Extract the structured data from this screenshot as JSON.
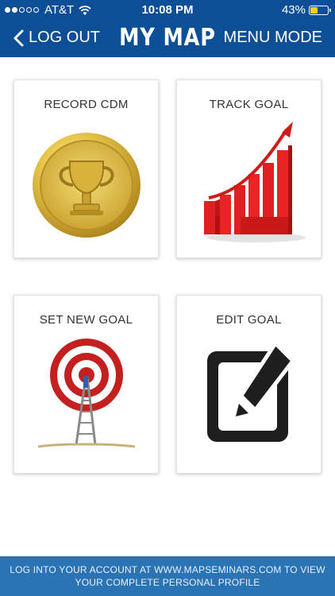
{
  "status_bar": {
    "carrier": "AT&T",
    "time": "10:08 PM",
    "battery": "43%",
    "battery_level": 0.43,
    "signal_bars_filled": 2,
    "signal_bars_total": 5
  },
  "nav": {
    "back_label": "LOG OUT",
    "title": "MY MAP",
    "menu_label": "MENU MODE"
  },
  "cards": [
    {
      "label": "RECORD CDM",
      "icon": "trophy-coin-icon"
    },
    {
      "label": "TRACK GOAL",
      "icon": "growth-chart-icon"
    },
    {
      "label": "SET NEW GOAL",
      "icon": "target-ladder-icon"
    },
    {
      "label": "EDIT GOAL",
      "icon": "edit-icon"
    }
  ],
  "footer": {
    "line1": "LOG INTO YOUR ACCOUNT AT WWW.MAPSEMINARS.COM TO VIEW",
    "line2": "YOUR COMPLETE PERSONAL PROFILE"
  },
  "colors": {
    "header_bg": "#0d4f96",
    "footer_bg": "#2a74b6",
    "battery_fill": "#f5d01a"
  }
}
